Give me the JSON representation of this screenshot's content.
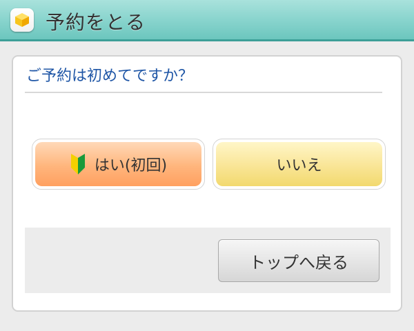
{
  "header": {
    "title": "予約をとる",
    "icon": "yellow-cube-icon"
  },
  "dialog": {
    "question": "ご予約は初めてですか？",
    "yes_button": {
      "label": "はい(初回)",
      "icon": "beginner-mark-icon"
    },
    "no_button": {
      "label": "いいえ"
    }
  },
  "footer": {
    "back_button_label": "トップへ戻る"
  },
  "colors": {
    "header_teal": "#86d3cc",
    "question_blue": "#1f56a6",
    "yes_orange": "#ffb57c",
    "no_yellow": "#f9e596"
  }
}
